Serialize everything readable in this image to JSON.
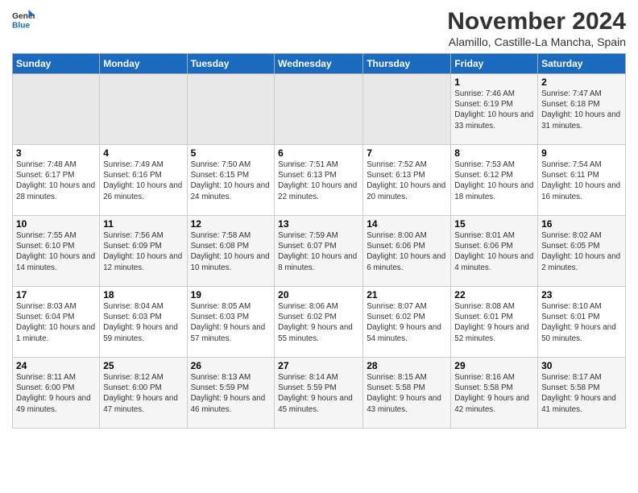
{
  "logo": {
    "general": "General",
    "blue": "Blue"
  },
  "header": {
    "month": "November 2024",
    "location": "Alamillo, Castille-La Mancha, Spain"
  },
  "weekdays": [
    "Sunday",
    "Monday",
    "Tuesday",
    "Wednesday",
    "Thursday",
    "Friday",
    "Saturday"
  ],
  "weeks": [
    [
      {
        "day": "",
        "info": ""
      },
      {
        "day": "",
        "info": ""
      },
      {
        "day": "",
        "info": ""
      },
      {
        "day": "",
        "info": ""
      },
      {
        "day": "",
        "info": ""
      },
      {
        "day": "1",
        "info": "Sunrise: 7:46 AM\nSunset: 6:19 PM\nDaylight: 10 hours and 33 minutes."
      },
      {
        "day": "2",
        "info": "Sunrise: 7:47 AM\nSunset: 6:18 PM\nDaylight: 10 hours and 31 minutes."
      }
    ],
    [
      {
        "day": "3",
        "info": "Sunrise: 7:48 AM\nSunset: 6:17 PM\nDaylight: 10 hours and 28 minutes."
      },
      {
        "day": "4",
        "info": "Sunrise: 7:49 AM\nSunset: 6:16 PM\nDaylight: 10 hours and 26 minutes."
      },
      {
        "day": "5",
        "info": "Sunrise: 7:50 AM\nSunset: 6:15 PM\nDaylight: 10 hours and 24 minutes."
      },
      {
        "day": "6",
        "info": "Sunrise: 7:51 AM\nSunset: 6:13 PM\nDaylight: 10 hours and 22 minutes."
      },
      {
        "day": "7",
        "info": "Sunrise: 7:52 AM\nSunset: 6:13 PM\nDaylight: 10 hours and 20 minutes."
      },
      {
        "day": "8",
        "info": "Sunrise: 7:53 AM\nSunset: 6:12 PM\nDaylight: 10 hours and 18 minutes."
      },
      {
        "day": "9",
        "info": "Sunrise: 7:54 AM\nSunset: 6:11 PM\nDaylight: 10 hours and 16 minutes."
      }
    ],
    [
      {
        "day": "10",
        "info": "Sunrise: 7:55 AM\nSunset: 6:10 PM\nDaylight: 10 hours and 14 minutes."
      },
      {
        "day": "11",
        "info": "Sunrise: 7:56 AM\nSunset: 6:09 PM\nDaylight: 10 hours and 12 minutes."
      },
      {
        "day": "12",
        "info": "Sunrise: 7:58 AM\nSunset: 6:08 PM\nDaylight: 10 hours and 10 minutes."
      },
      {
        "day": "13",
        "info": "Sunrise: 7:59 AM\nSunset: 6:07 PM\nDaylight: 10 hours and 8 minutes."
      },
      {
        "day": "14",
        "info": "Sunrise: 8:00 AM\nSunset: 6:06 PM\nDaylight: 10 hours and 6 minutes."
      },
      {
        "day": "15",
        "info": "Sunrise: 8:01 AM\nSunset: 6:06 PM\nDaylight: 10 hours and 4 minutes."
      },
      {
        "day": "16",
        "info": "Sunrise: 8:02 AM\nSunset: 6:05 PM\nDaylight: 10 hours and 2 minutes."
      }
    ],
    [
      {
        "day": "17",
        "info": "Sunrise: 8:03 AM\nSunset: 6:04 PM\nDaylight: 10 hours and 1 minute."
      },
      {
        "day": "18",
        "info": "Sunrise: 8:04 AM\nSunset: 6:03 PM\nDaylight: 9 hours and 59 minutes."
      },
      {
        "day": "19",
        "info": "Sunrise: 8:05 AM\nSunset: 6:03 PM\nDaylight: 9 hours and 57 minutes."
      },
      {
        "day": "20",
        "info": "Sunrise: 8:06 AM\nSunset: 6:02 PM\nDaylight: 9 hours and 55 minutes."
      },
      {
        "day": "21",
        "info": "Sunrise: 8:07 AM\nSunset: 6:02 PM\nDaylight: 9 hours and 54 minutes."
      },
      {
        "day": "22",
        "info": "Sunrise: 8:08 AM\nSunset: 6:01 PM\nDaylight: 9 hours and 52 minutes."
      },
      {
        "day": "23",
        "info": "Sunrise: 8:10 AM\nSunset: 6:01 PM\nDaylight: 9 hours and 50 minutes."
      }
    ],
    [
      {
        "day": "24",
        "info": "Sunrise: 8:11 AM\nSunset: 6:00 PM\nDaylight: 9 hours and 49 minutes."
      },
      {
        "day": "25",
        "info": "Sunrise: 8:12 AM\nSunset: 6:00 PM\nDaylight: 9 hours and 47 minutes."
      },
      {
        "day": "26",
        "info": "Sunrise: 8:13 AM\nSunset: 5:59 PM\nDaylight: 9 hours and 46 minutes."
      },
      {
        "day": "27",
        "info": "Sunrise: 8:14 AM\nSunset: 5:59 PM\nDaylight: 9 hours and 45 minutes."
      },
      {
        "day": "28",
        "info": "Sunrise: 8:15 AM\nSunset: 5:58 PM\nDaylight: 9 hours and 43 minutes."
      },
      {
        "day": "29",
        "info": "Sunrise: 8:16 AM\nSunset: 5:58 PM\nDaylight: 9 hours and 42 minutes."
      },
      {
        "day": "30",
        "info": "Sunrise: 8:17 AM\nSunset: 5:58 PM\nDaylight: 9 hours and 41 minutes."
      }
    ]
  ]
}
